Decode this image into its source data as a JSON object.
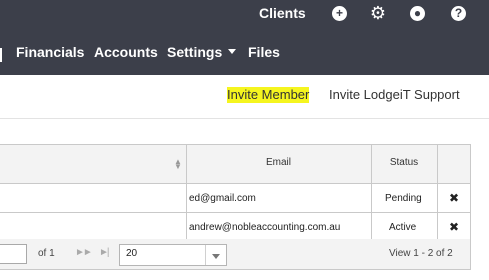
{
  "header": {
    "clients_label": "Clients",
    "icons": [
      "plus-circle-icon",
      "gear-icon",
      "user-circle-icon",
      "help-circle-icon"
    ]
  },
  "nav": {
    "items": [
      {
        "label": "Financials"
      },
      {
        "label": "Accounts"
      },
      {
        "label": "Settings",
        "has_dropdown": true
      },
      {
        "label": "Files"
      }
    ]
  },
  "actions": {
    "invite_member": "Invite Member",
    "invite_support": "Invite LodgeiT Support",
    "highlight_color": "#f5f51f"
  },
  "table": {
    "columns": [
      "",
      "Email",
      "Status",
      ""
    ],
    "rows": [
      {
        "email": "ed@gmail.com",
        "status": "Pending"
      },
      {
        "email": "andrew@nobleaccounting.com.au",
        "status": "Active"
      }
    ]
  },
  "pager": {
    "of_text": "of 1",
    "rows_per_page": "20",
    "view_info": "View 1 - 2 of 2"
  }
}
